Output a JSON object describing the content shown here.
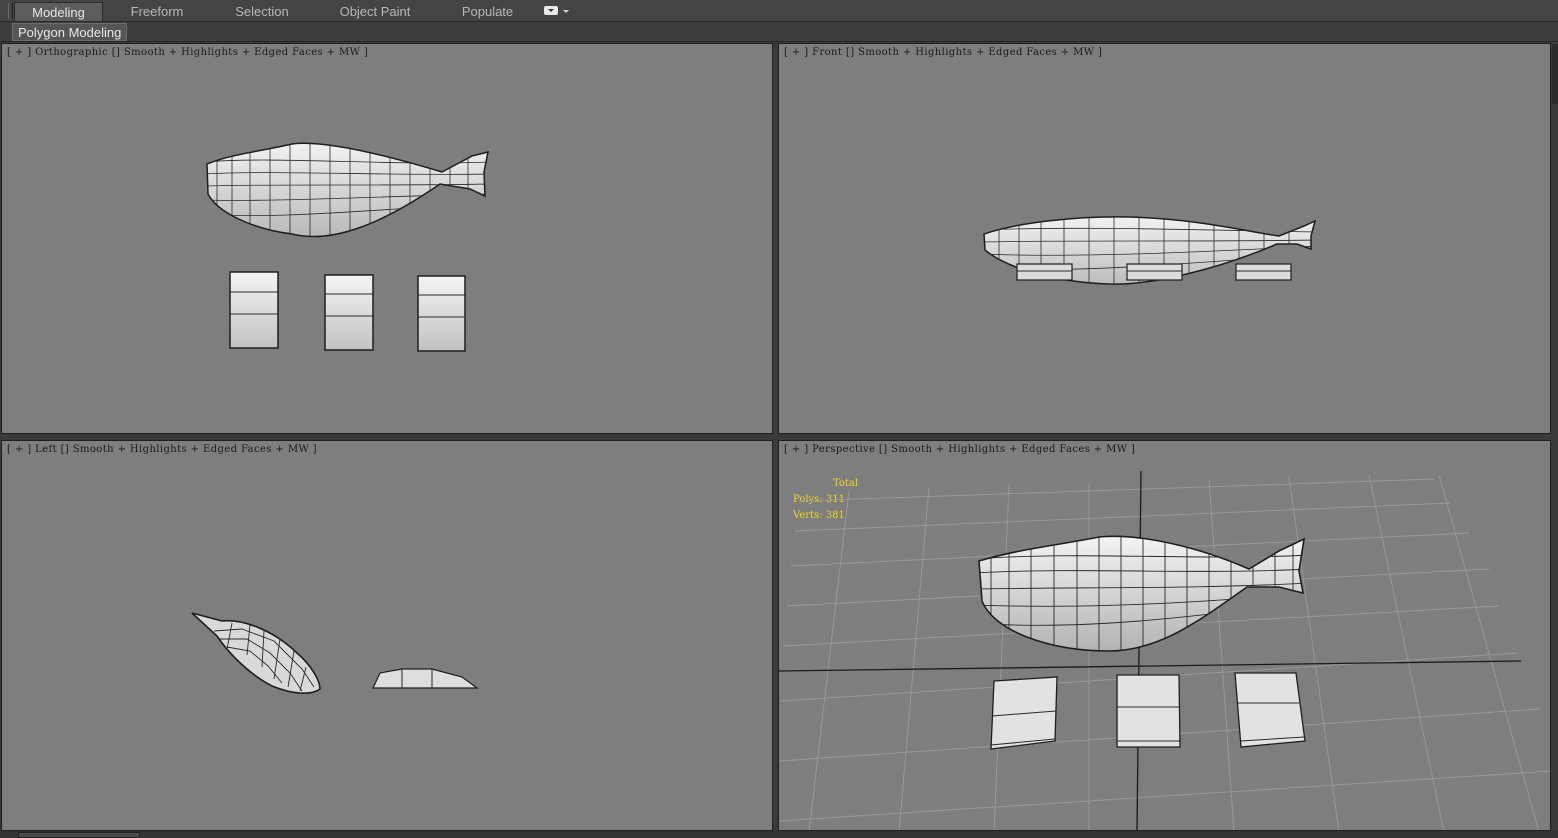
{
  "ribbon": {
    "tabs": [
      {
        "label": "Modeling",
        "active": true
      },
      {
        "label": "Freeform",
        "active": false
      },
      {
        "label": "Selection",
        "active": false
      },
      {
        "label": "Object Paint",
        "active": false
      },
      {
        "label": "Populate",
        "active": false
      }
    ],
    "menu_icon": "ribbon-options-icon"
  },
  "subpanel": {
    "label": "Polygon Modeling"
  },
  "viewports": {
    "top_left": {
      "label": "[ + ] Orthographic [] Smooth + Highlights + Edged Faces + MW ]"
    },
    "top_right": {
      "label": "[ + ] Front [] Smooth + Highlights + Edged Faces + MW ]"
    },
    "bottom_left": {
      "label": "[ + ] Left [] Smooth + Highlights + Edged Faces + MW ]"
    },
    "bottom_right": {
      "label": "[ + ] Perspective [] Smooth + Highlights + Edged Faces + MW ]"
    }
  },
  "stats": {
    "header": "Total",
    "polys": "Polys: 311",
    "verts": "Verts: 381"
  },
  "colors": {
    "viewport_bg": "#7e7e7e",
    "stats_text": "#f0d81f",
    "mesh_fill": "#e6e6e6",
    "mesh_edge": "#1e1e1e"
  }
}
